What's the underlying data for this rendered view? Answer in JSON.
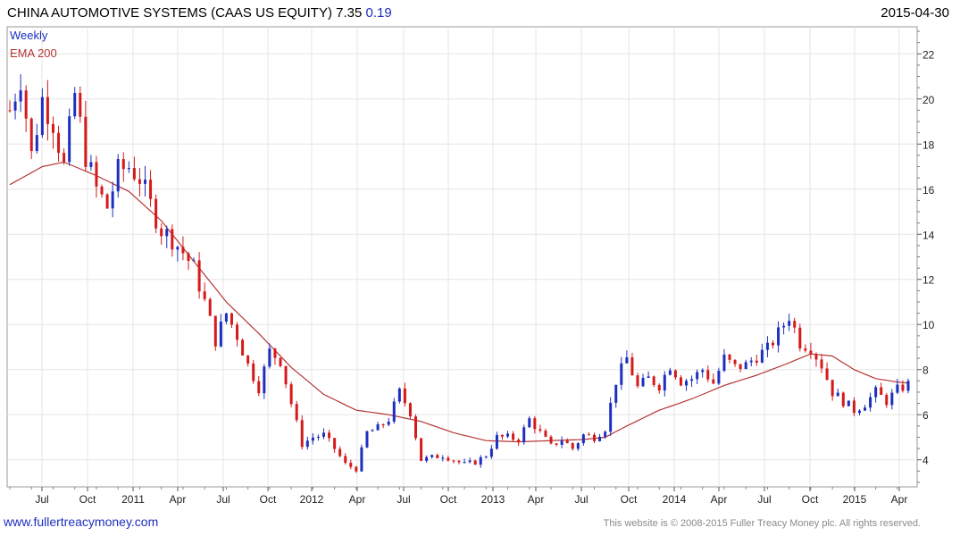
{
  "header": {
    "title": "CHINA AUTOMOTIVE SYSTEMS (CAAS US EQUITY) 7.35",
    "change": "0.19",
    "date": "2015-04-30"
  },
  "legend": {
    "weekly": "Weekly",
    "ema": "EMA 200"
  },
  "footer": {
    "site": "www.fullertreacymoney.com",
    "copyright": "This website is © 2008-2015 Fuller Treacy Money plc. All rights reserved."
  },
  "colors": {
    "up": "#1d2fbf",
    "down": "#d41a1a",
    "ema": "#b53535",
    "grid": "#e6e6e6",
    "text_accent": "#1d2fbf"
  },
  "chart_data": {
    "type": "candlestick",
    "frequency": "weekly",
    "ylim": [
      2.8,
      23.2
    ],
    "y_ticks": [
      4,
      6,
      8,
      10,
      12,
      14,
      16,
      18,
      20,
      22
    ],
    "x_tick_labels": [
      "Jul",
      "Oct",
      "2011",
      "Apr",
      "Jul",
      "Oct",
      "2012",
      "Apr",
      "Jul",
      "Oct",
      "2013",
      "Apr",
      "Jul",
      "Oct",
      "2014",
      "Apr",
      "Jul",
      "Oct",
      "2015",
      "Apr"
    ],
    "grid": true,
    "legend_position": "top-left",
    "price_points": [
      [
        0,
        19.5
      ],
      [
        2,
        21.0
      ],
      [
        4,
        17.5
      ],
      [
        6,
        20.0
      ],
      [
        8,
        19.0
      ],
      [
        10,
        17.0
      ],
      [
        12,
        20.2
      ],
      [
        14,
        17.5
      ],
      [
        16,
        16.0
      ],
      [
        18,
        15.2
      ],
      [
        20,
        16.8
      ],
      [
        22,
        17.0
      ],
      [
        24,
        16.5
      ],
      [
        26,
        15.3
      ],
      [
        28,
        14.2
      ],
      [
        30,
        13.8
      ],
      [
        32,
        13.2
      ],
      [
        34,
        12.5
      ],
      [
        36,
        11.0
      ],
      [
        38,
        9.3
      ],
      [
        40,
        10.5
      ],
      [
        42,
        9.5
      ],
      [
        44,
        8.2
      ],
      [
        46,
        7.2
      ],
      [
        48,
        8.8
      ],
      [
        50,
        8.4
      ],
      [
        52,
        6.5
      ],
      [
        54,
        4.7
      ],
      [
        56,
        5.0
      ],
      [
        58,
        5.1
      ],
      [
        60,
        4.5
      ],
      [
        62,
        3.8
      ],
      [
        64,
        3.6
      ],
      [
        66,
        5.2
      ],
      [
        68,
        5.4
      ],
      [
        70,
        5.8
      ],
      [
        72,
        7.0
      ],
      [
        74,
        6.1
      ],
      [
        76,
        4.0
      ],
      [
        78,
        4.1
      ],
      [
        80,
        4.2
      ],
      [
        82,
        4.0
      ],
      [
        84,
        3.8
      ],
      [
        86,
        3.9
      ],
      [
        88,
        4.2
      ],
      [
        90,
        5.0
      ],
      [
        92,
        5.0
      ],
      [
        94,
        4.9
      ],
      [
        96,
        5.8
      ],
      [
        98,
        5.2
      ],
      [
        100,
        4.6
      ],
      [
        102,
        4.9
      ],
      [
        104,
        4.5
      ],
      [
        106,
        5.1
      ],
      [
        108,
        5.0
      ],
      [
        110,
        5.4
      ],
      [
        112,
        7.5
      ],
      [
        114,
        8.5
      ],
      [
        116,
        7.2
      ],
      [
        118,
        7.6
      ],
      [
        120,
        7.3
      ],
      [
        122,
        8.2
      ],
      [
        124,
        7.5
      ],
      [
        126,
        7.6
      ],
      [
        128,
        8.0
      ],
      [
        130,
        7.4
      ],
      [
        132,
        8.5
      ],
      [
        134,
        8.1
      ],
      [
        136,
        8.2
      ],
      [
        138,
        8.6
      ],
      [
        140,
        8.9
      ],
      [
        142,
        9.6
      ],
      [
        144,
        10.4
      ],
      [
        146,
        9.2
      ],
      [
        148,
        9.0
      ],
      [
        150,
        8.2
      ],
      [
        152,
        7.0
      ],
      [
        154,
        6.6
      ],
      [
        156,
        6.2
      ],
      [
        158,
        6.5
      ],
      [
        160,
        7.0
      ],
      [
        162,
        6.6
      ],
      [
        164,
        7.1
      ],
      [
        166,
        7.35
      ]
    ],
    "ema_points": [
      [
        0,
        16.2
      ],
      [
        6,
        17.0
      ],
      [
        10,
        17.2
      ],
      [
        16,
        16.6
      ],
      [
        22,
        15.9
      ],
      [
        28,
        14.6
      ],
      [
        34,
        12.8
      ],
      [
        40,
        11.0
      ],
      [
        46,
        9.6
      ],
      [
        52,
        8.1
      ],
      [
        58,
        6.9
      ],
      [
        64,
        6.2
      ],
      [
        70,
        6.0
      ],
      [
        76,
        5.7
      ],
      [
        82,
        5.2
      ],
      [
        88,
        4.85
      ],
      [
        94,
        4.8
      ],
      [
        100,
        4.85
      ],
      [
        106,
        4.9
      ],
      [
        110,
        5.0
      ],
      [
        114,
        5.5
      ],
      [
        120,
        6.2
      ],
      [
        126,
        6.7
      ],
      [
        132,
        7.3
      ],
      [
        138,
        7.75
      ],
      [
        144,
        8.3
      ],
      [
        148,
        8.7
      ],
      [
        152,
        8.6
      ],
      [
        156,
        8.0
      ],
      [
        160,
        7.6
      ],
      [
        164,
        7.45
      ],
      [
        166,
        7.4
      ]
    ]
  }
}
